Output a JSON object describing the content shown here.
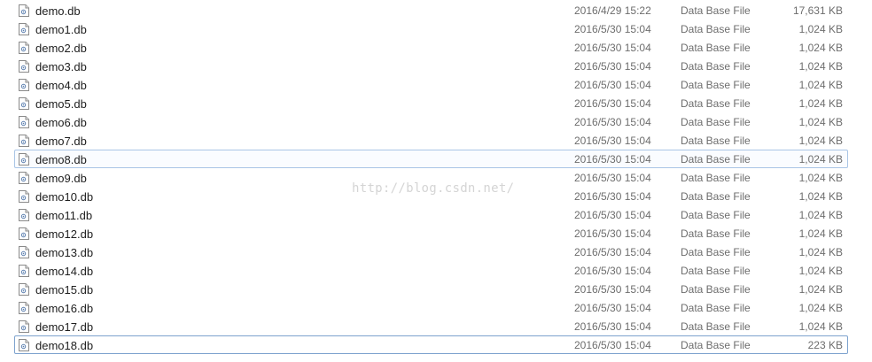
{
  "file_list": {
    "rows": [
      {
        "name": "demo.db",
        "date": "2016/4/29 15:22",
        "type": "Data Base File",
        "size": "17,631 KB"
      },
      {
        "name": "demo1.db",
        "date": "2016/5/30 15:04",
        "type": "Data Base File",
        "size": "1,024 KB"
      },
      {
        "name": "demo2.db",
        "date": "2016/5/30 15:04",
        "type": "Data Base File",
        "size": "1,024 KB"
      },
      {
        "name": "demo3.db",
        "date": "2016/5/30 15:04",
        "type": "Data Base File",
        "size": "1,024 KB"
      },
      {
        "name": "demo4.db",
        "date": "2016/5/30 15:04",
        "type": "Data Base File",
        "size": "1,024 KB"
      },
      {
        "name": "demo5.db",
        "date": "2016/5/30 15:04",
        "type": "Data Base File",
        "size": "1,024 KB"
      },
      {
        "name": "demo6.db",
        "date": "2016/5/30 15:04",
        "type": "Data Base File",
        "size": "1,024 KB"
      },
      {
        "name": "demo7.db",
        "date": "2016/5/30 15:04",
        "type": "Data Base File",
        "size": "1,024 KB"
      },
      {
        "name": "demo8.db",
        "date": "2016/5/30 15:04",
        "type": "Data Base File",
        "size": "1,024 KB"
      },
      {
        "name": "demo9.db",
        "date": "2016/5/30 15:04",
        "type": "Data Base File",
        "size": "1,024 KB"
      },
      {
        "name": "demo10.db",
        "date": "2016/5/30 15:04",
        "type": "Data Base File",
        "size": "1,024 KB"
      },
      {
        "name": "demo11.db",
        "date": "2016/5/30 15:04",
        "type": "Data Base File",
        "size": "1,024 KB"
      },
      {
        "name": "demo12.db",
        "date": "2016/5/30 15:04",
        "type": "Data Base File",
        "size": "1,024 KB"
      },
      {
        "name": "demo13.db",
        "date": "2016/5/30 15:04",
        "type": "Data Base File",
        "size": "1,024 KB"
      },
      {
        "name": "demo14.db",
        "date": "2016/5/30 15:04",
        "type": "Data Base File",
        "size": "1,024 KB"
      },
      {
        "name": "demo15.db",
        "date": "2016/5/30 15:04",
        "type": "Data Base File",
        "size": "1,024 KB"
      },
      {
        "name": "demo16.db",
        "date": "2016/5/30 15:04",
        "type": "Data Base File",
        "size": "1,024 KB"
      },
      {
        "name": "demo17.db",
        "date": "2016/5/30 15:04",
        "type": "Data Base File",
        "size": "1,024 KB"
      },
      {
        "name": "demo18.db",
        "date": "2016/5/30 15:04",
        "type": "Data Base File",
        "size": "223 KB"
      }
    ],
    "hovered_row": "demo8.db",
    "selected_row": "demo18.db",
    "icon": "file-icon"
  },
  "watermark": "http://blog.csdn.net/"
}
